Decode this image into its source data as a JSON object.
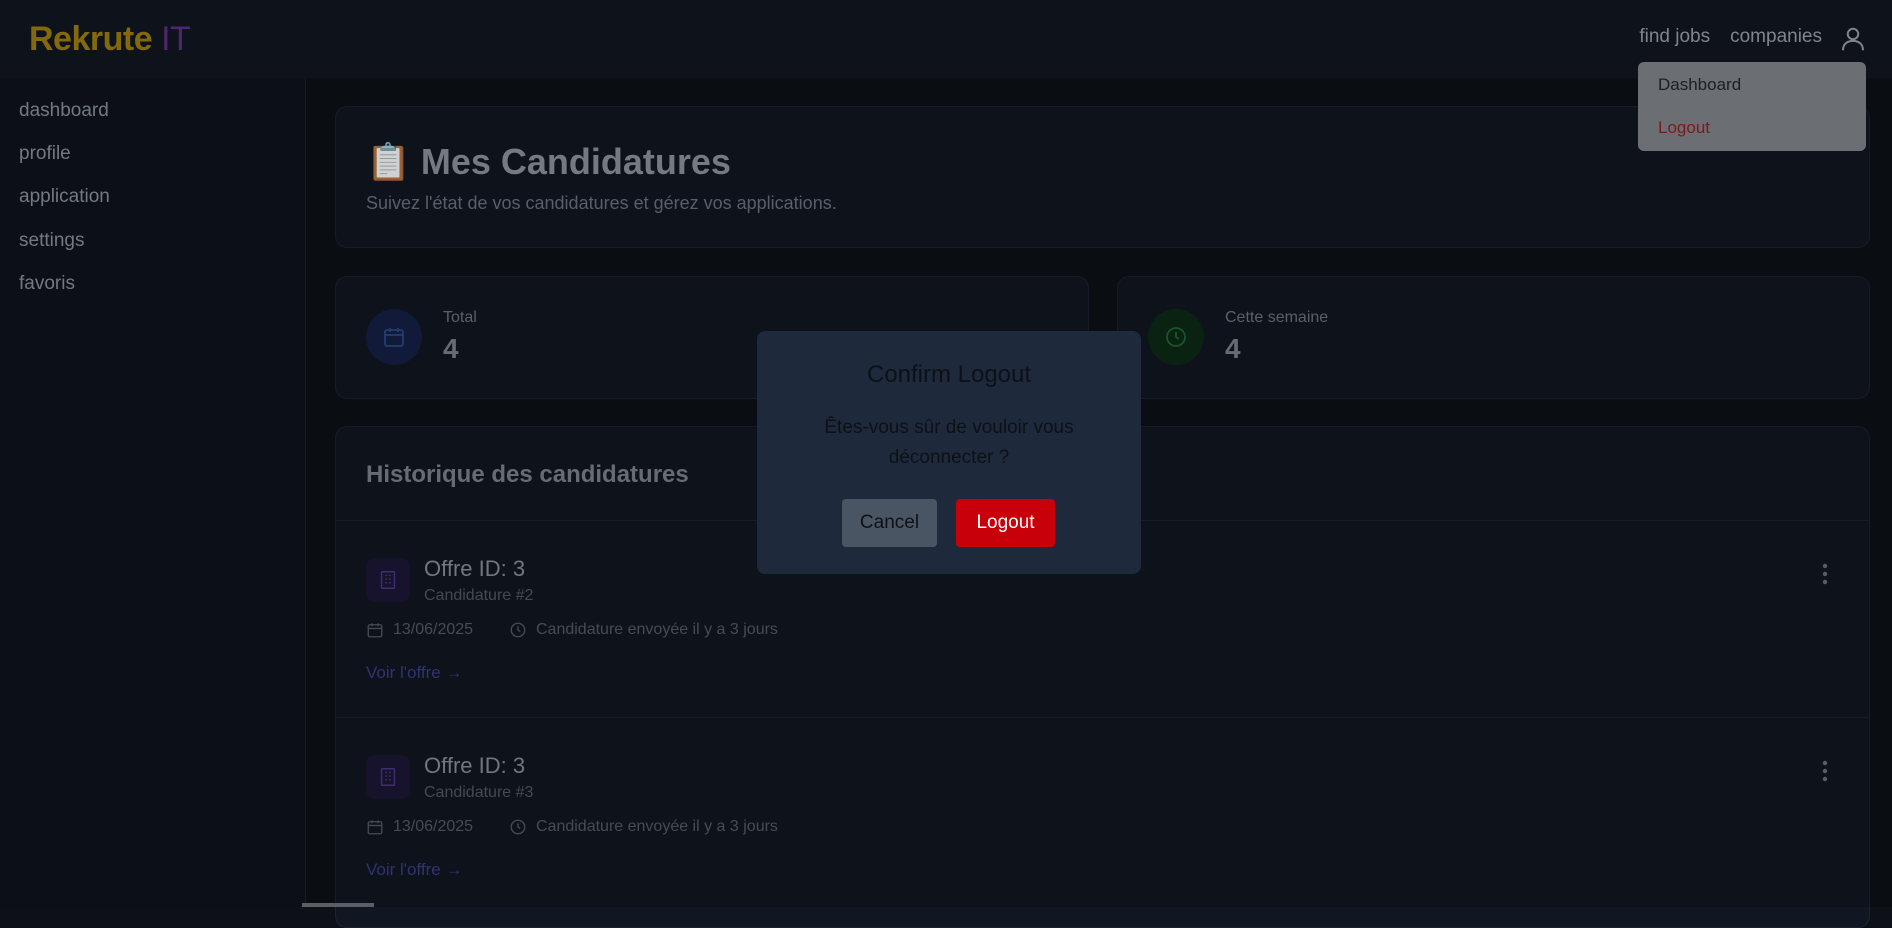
{
  "brand": {
    "part1": "Rekrute",
    "part2": "IT"
  },
  "nav": {
    "find_jobs": "find jobs",
    "companies": "companies",
    "user_icon": "user-icon"
  },
  "dropdown": {
    "dashboard": "Dashboard",
    "logout": "Logout"
  },
  "sidebar": {
    "items": [
      {
        "label": "dashboard"
      },
      {
        "label": "profile"
      },
      {
        "label": "application"
      },
      {
        "label": "settings"
      },
      {
        "label": "favoris"
      }
    ]
  },
  "hero": {
    "title": "📋 Mes Candidatures",
    "subtitle": "Suivez l'état de vos candidatures et gérez vos applications."
  },
  "stats": [
    {
      "label": "Total",
      "value": "4",
      "icon": "calendar-icon",
      "color": "#1e2a4d"
    },
    {
      "label": "Cette semaine",
      "value": "4",
      "icon": "clock-icon",
      "color": "#0f3a1e"
    }
  ],
  "history": {
    "title": "Historique des candidatures",
    "items": [
      {
        "title": "Offre ID: 3",
        "subtitle": "Candidature #2",
        "date": "13/06/2025",
        "status": "Candidature envoyée il y a 3 jours",
        "link": "Voir l'offre →"
      },
      {
        "title": "Offre ID: 3",
        "subtitle": "Candidature #3",
        "date": "13/06/2025",
        "status": "Candidature envoyée il y a 3 jours",
        "link": "Voir l'offre →"
      }
    ]
  },
  "modal": {
    "title": "Confirm Logout",
    "message": "Êtes-vous sûr de vouloir vous déconnecter ?",
    "cancel": "Cancel",
    "confirm": "Logout"
  },
  "colors": {
    "accent_brand": "#a0800e",
    "logout_button": "#c8000a",
    "link": "#3a3f8a"
  }
}
